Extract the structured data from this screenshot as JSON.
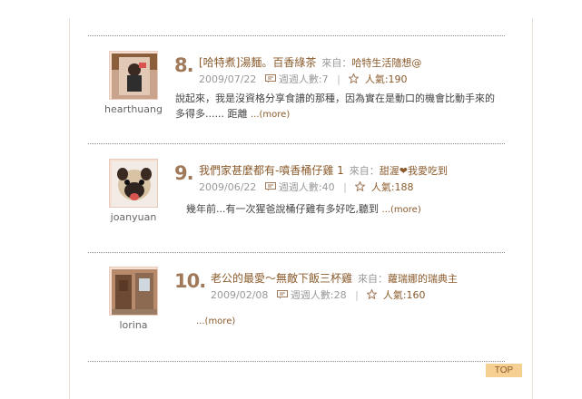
{
  "entries": [
    {
      "rank": "8.",
      "title": "[哈特煮]湯麵。百香綠茶",
      "from_label": "來自：",
      "source": "哈特生活隨想@",
      "date": "2009/07/22",
      "weekly_label": "週週人數:7",
      "popularity_label": "人氣:190",
      "excerpt": "說起來，我是沒資格分享食譜的那種，因為實在是動口的機會比動手來的多得多...... 距離 ",
      "more": "...(more)",
      "username": "hearthuang",
      "avatar_icon": "user-photo-icon"
    },
    {
      "rank": "9.",
      "title": "我們家甚麼都有-噴香桶仔雞 1",
      "from_label": "來自：",
      "source": "甜渥❤我愛吃到",
      "date": "2009/06/22",
      "weekly_label": "週週人數:40",
      "popularity_label": "人氣:188",
      "excerpt": "幾年前...有一次猩爸說桶仔雞有多好吃,聽到 ",
      "more": "...(more)",
      "username": "joanyuan",
      "avatar_icon": "pug-photo-icon"
    },
    {
      "rank": "10.",
      "title": "老公的最愛～無敵下飯三杯雞",
      "from_label": "來自：",
      "source": "蘿瑞娜的瑞典主",
      "date": "2009/02/08",
      "weekly_label": "週週人數:28",
      "popularity_label": "人氣:160",
      "excerpt": "",
      "more": "...(more)",
      "username": "lorina",
      "avatar_icon": "door-photo-icon"
    }
  ],
  "top_button": "TOP",
  "colors": {
    "accent": "#8a5a2b",
    "rank": "#a0785a",
    "top_bg": "#f6cf93"
  }
}
